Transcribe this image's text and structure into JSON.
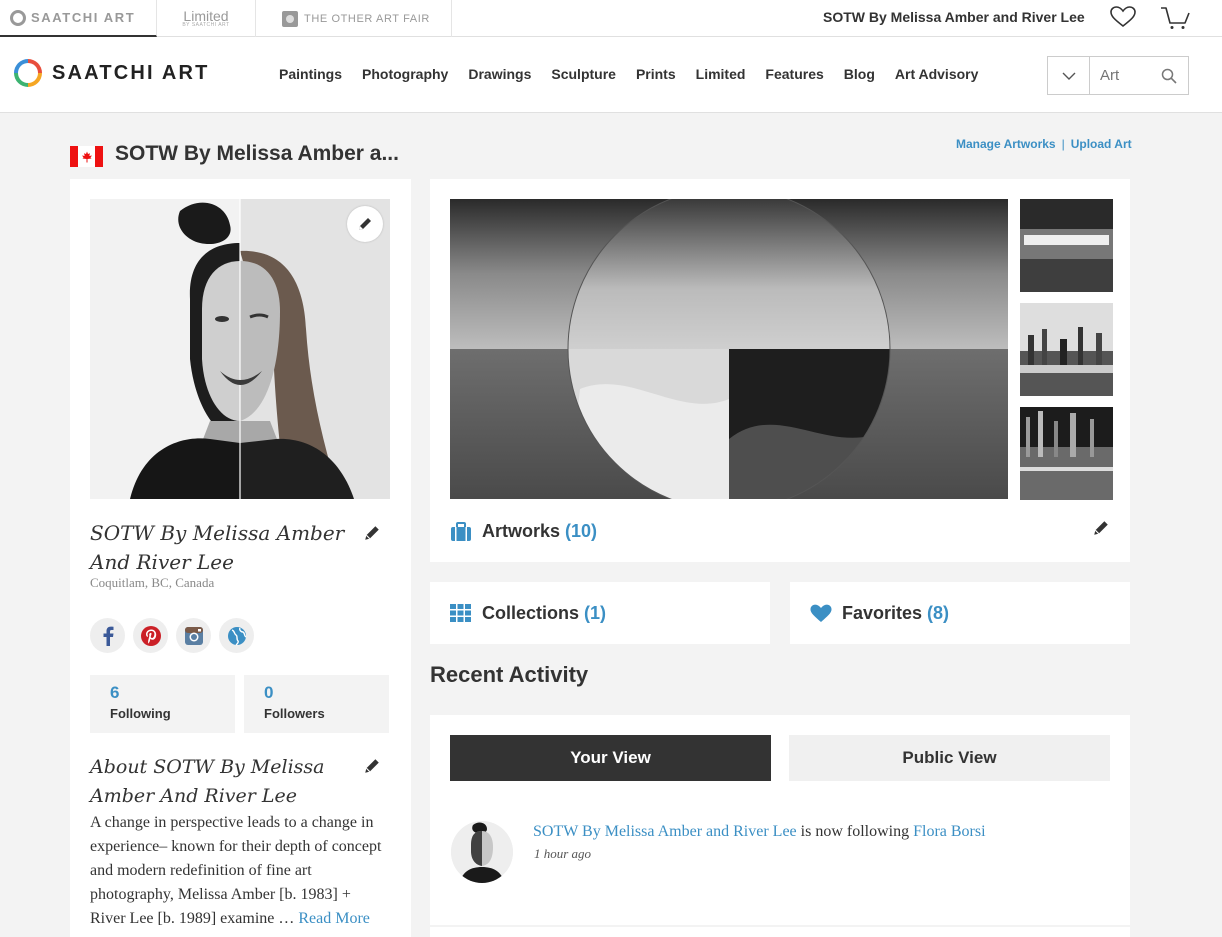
{
  "topbar": {
    "tabs": [
      "SAATCHI ART",
      "Limited",
      "BY SAATCHI ART",
      "THE OTHER ART FAIR"
    ],
    "user_name": "SOTW By Melissa Amber and River Lee"
  },
  "nav": {
    "logo_text": "SAATCHI ART",
    "links": [
      "Paintings",
      "Photography",
      "Drawings",
      "Sculpture",
      "Prints",
      "Limited",
      "Features",
      "Blog",
      "Art Advisory"
    ],
    "search_placeholder": "Art"
  },
  "header": {
    "title": "SOTW By Melissa Amber a...",
    "manage_label": "Manage Artworks",
    "upload_label": "Upload Art"
  },
  "profile": {
    "name": "SOTW By Melissa Amber And River Lee",
    "location": "Coquitlam, BC, Canada",
    "socials": [
      "facebook-icon",
      "pinterest-icon",
      "instagram-icon",
      "website-icon"
    ],
    "following_count": "6",
    "following_label": "Following",
    "followers_count": "0",
    "followers_label": "Followers",
    "about_title": "About SOTW By Melissa Amber And River Lee",
    "bio": "A change in perspective leads to a change in experience– known for their depth of concept and modern redefinition of fine art photography, Melissa Amber [b. 1983] + River Lee [b. 1989] examine …",
    "read_more": "Read More"
  },
  "artworks": {
    "label": "Artworks",
    "count": "(10)"
  },
  "collections": {
    "label": "Collections",
    "count": "(1)"
  },
  "favorites": {
    "label": "Favorites",
    "count": "(8)"
  },
  "activity": {
    "heading": "Recent Activity",
    "your_view": "Your View",
    "public_view": "Public View",
    "items": [
      {
        "actor": "SOTW By Melissa Amber and River Lee",
        "verb": "is now following",
        "target": "Flora Borsi",
        "time": "1 hour ago"
      }
    ]
  },
  "colors": {
    "accent": "#3b8fc4",
    "dark_button": "#333333"
  }
}
